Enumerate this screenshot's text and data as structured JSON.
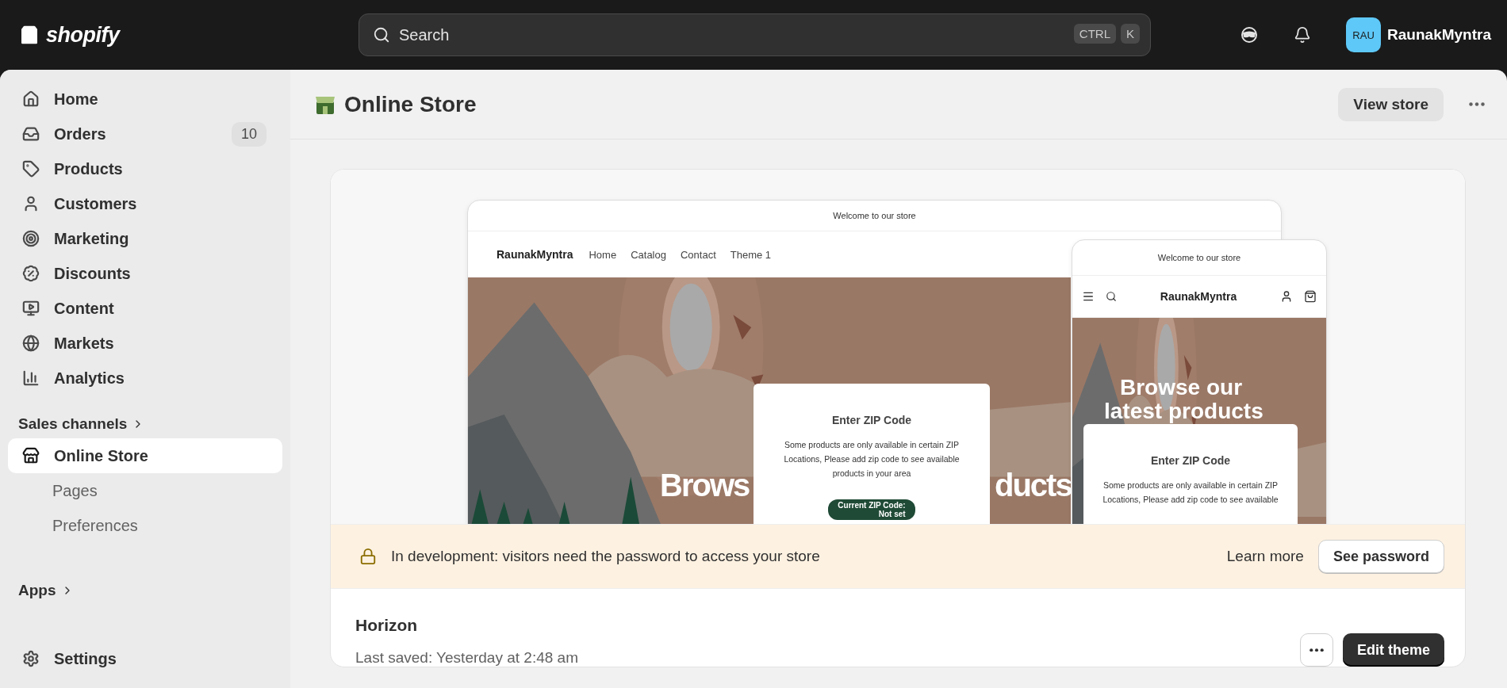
{
  "topbar": {
    "logo": "shopify",
    "search": {
      "placeholder": "Search",
      "keys": [
        "CTRL",
        "K"
      ]
    },
    "avatar": "RAU",
    "user": "RaunakMyntra"
  },
  "sidebar": {
    "items": [
      {
        "label": "Home",
        "selected": false
      },
      {
        "label": "Orders",
        "selected": false,
        "badge": "10"
      },
      {
        "label": "Products",
        "selected": false
      },
      {
        "label": "Customers",
        "selected": false
      },
      {
        "label": "Marketing",
        "selected": false
      },
      {
        "label": "Discounts",
        "selected": false
      },
      {
        "label": "Content",
        "selected": false
      },
      {
        "label": "Markets",
        "selected": false
      },
      {
        "label": "Analytics",
        "selected": false
      }
    ],
    "sales_channels": {
      "title": "Sales channels",
      "items": [
        {
          "label": "Online Store",
          "selected": true,
          "children": [
            {
              "label": "Pages",
              "selected": false
            },
            {
              "label": "Preferences",
              "selected": false
            }
          ]
        }
      ]
    },
    "apps": {
      "title": "Apps"
    },
    "settings": {
      "label": "Settings",
      "selected": false
    }
  },
  "page": {
    "title": "Online Store",
    "button": "View store"
  },
  "preview": {
    "desktop": {
      "announcement": "Welcome to our store",
      "brand": "RaunakMyntra",
      "nav": [
        "Home",
        "Catalog",
        "Contact",
        "Theme 1"
      ],
      "hero_left": "Brows",
      "hero_right": "ducts",
      "modal": {
        "title": "Enter ZIP Code",
        "text": "Some products are only available in certain ZIP Locations, Please add zip code to see available products in your area",
        "zip_label": "Current ZIP Code:",
        "zip_value": "Not set"
      }
    },
    "mobile": {
      "announcement": "Welcome to our store",
      "brand": "RaunakMyntra",
      "hero_lines": [
        "Browse our",
        "latest products"
      ],
      "modal": {
        "title": "Enter ZIP Code",
        "text": "Some products are only available in certain ZIP Locations, Please add zip code to see available"
      }
    }
  },
  "banner": {
    "text": "In development: visitors need the password to access your store",
    "link": "Learn more",
    "button": "See password"
  },
  "theme": {
    "name": "Horizon",
    "saved": "Last saved: Yesterday at 2:48 am",
    "button": "Edit theme"
  }
}
